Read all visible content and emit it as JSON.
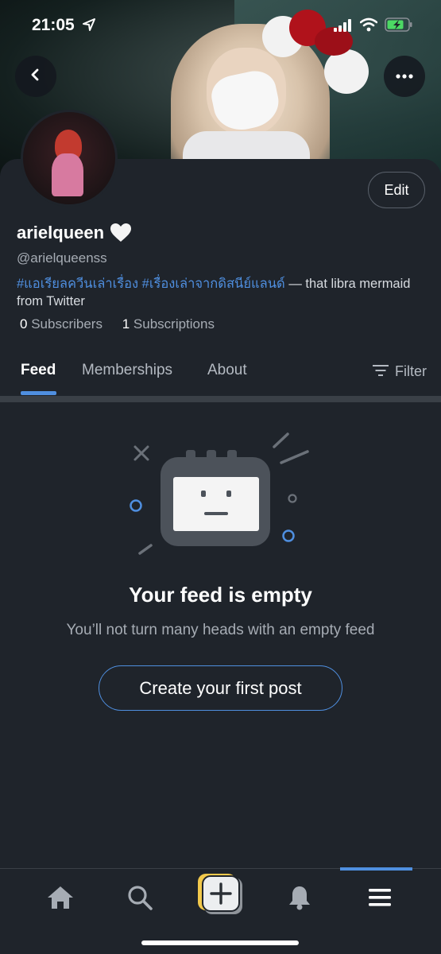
{
  "status_bar": {
    "time": "21:05"
  },
  "profile": {
    "display_name": "arielqueen",
    "handle": "@arielqueenss",
    "bio_tag_1": "#แอเรียลควีนเล่าเรื่อง",
    "bio_tag_2": "#เรื่องเล่าจากดิสนีย์แลนด์",
    "bio_text": " — that libra mermaid from Twitter",
    "subscribers_count": "0",
    "subscribers_label": "Subscribers",
    "subscriptions_count": "1",
    "subscriptions_label": "Subscriptions",
    "edit_label": "Edit"
  },
  "tabs": [
    {
      "label": "Feed",
      "active": true
    },
    {
      "label": "Memberships",
      "active": false
    },
    {
      "label": "About",
      "active": false
    }
  ],
  "filter_label": "Filter",
  "empty_state": {
    "title": "Your feed is empty",
    "subtitle": "You’ll not turn many heads with an empty feed",
    "button": "Create your first post"
  },
  "bottom_nav": [
    {
      "icon": "home-icon",
      "active": false
    },
    {
      "icon": "search-icon",
      "active": false
    },
    {
      "icon": "plus-icon",
      "active": false
    },
    {
      "icon": "bell-icon",
      "active": false
    },
    {
      "icon": "menu-icon",
      "active": true
    }
  ],
  "colors": {
    "accent": "#4f8fe0",
    "background": "#1f242b",
    "muted_text": "#a6acb4",
    "plus_button": "#f2c94c"
  }
}
